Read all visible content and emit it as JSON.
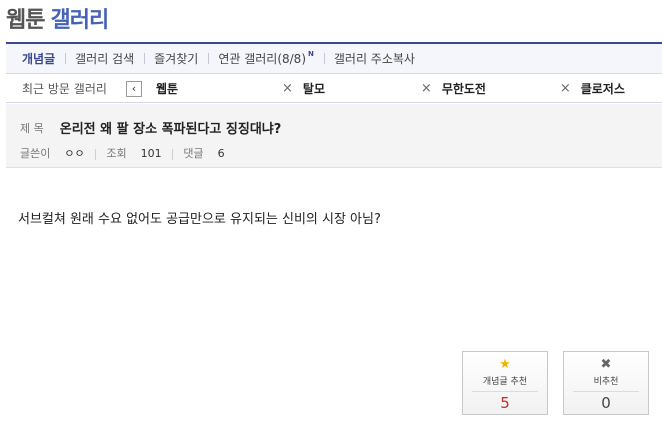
{
  "header": {
    "title_part1": "웹툰",
    "title_part2": "갤러리"
  },
  "tabs": [
    {
      "label": "개념글",
      "active": true
    },
    {
      "label": "갤러리 검색"
    },
    {
      "label": "즐겨찾기"
    },
    {
      "label": "연관 갤러리(8/8)",
      "badge": "N"
    },
    {
      "label": "갤러리 주소복사"
    }
  ],
  "recent": {
    "label": "최근 방문 갤러리",
    "prev_icon": "‹",
    "close_icon": "×",
    "items": [
      "웹툰",
      "탈모",
      "무한도전",
      "클로저스"
    ]
  },
  "post": {
    "subject_label": "제 목",
    "subject": "온리전 왜 팔 장소 폭파된다고 징징대냐?",
    "author_label": "글쓴이",
    "author": "ㅇㅇ",
    "views_label": "조회",
    "views": "101",
    "comments_label": "댓글",
    "comments": "6",
    "body": "서브컬쳐 원래 수요 없어도 공급만으로 유지되는 신비의 시장 아님?"
  },
  "vote": {
    "up_label": "개념글 추천",
    "up_count": "5",
    "up_icon": "star-icon",
    "down_label": "비추천",
    "down_count": "0",
    "down_icon": "x-icon"
  }
}
